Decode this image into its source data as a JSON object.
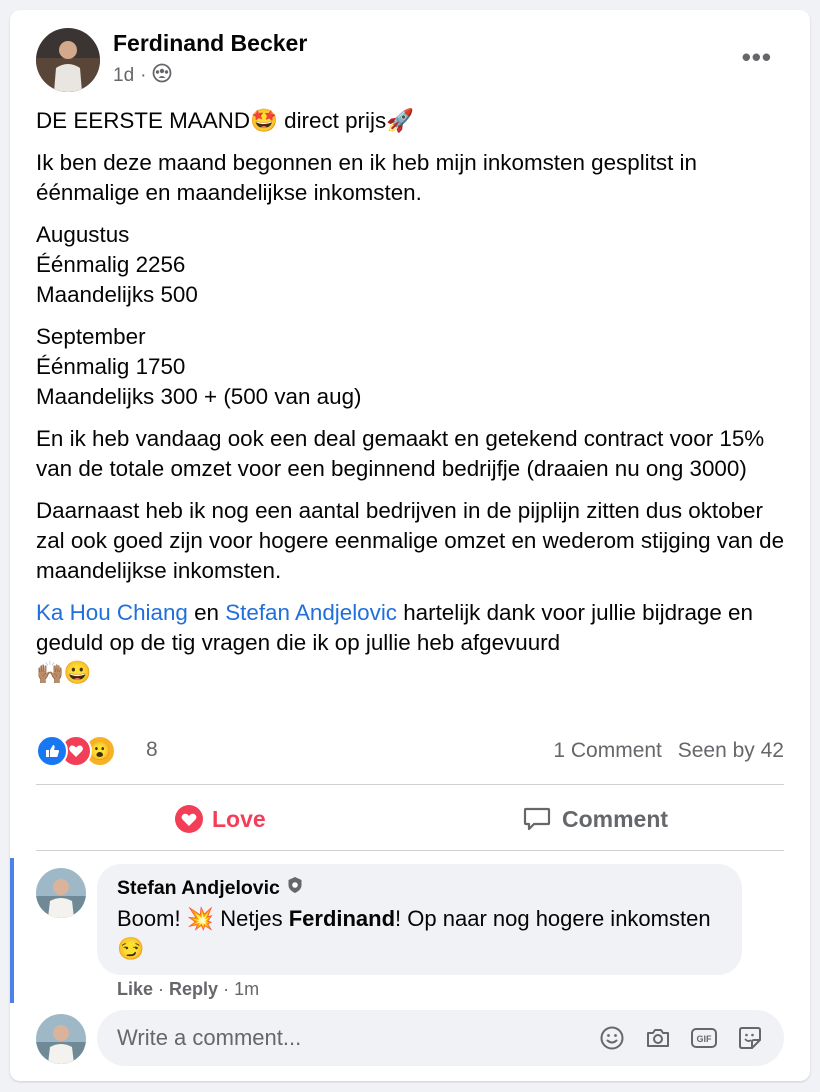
{
  "post": {
    "author": "Ferdinand Becker",
    "time": "1d",
    "separator": "·",
    "more": "•••",
    "title_text": "DE EERSTE MAAND",
    "title_emoji_1": "🤩",
    "title_text_2": " direct prijs",
    "title_emoji_2": "🚀",
    "p2": "Ik ben deze maand begonnen en ik heb mijn inkomsten gesplitst in éénmalige en maandelijkse inkomsten.",
    "aug_1": "Augustus",
    "aug_2": "Éénmalig 2256",
    "aug_3": "Maandelijks 500",
    "sep_1": "September",
    "sep_2": "Éénmalig 1750",
    "sep_3": "Maandelijks 300 + (500 van aug)",
    "p5": "En ik heb vandaag ook een deal gemaakt en getekend contract voor 15% van de totale omzet voor een beginnend bedrijfje (draaien nu ong 3000)",
    "p6": "Daarnaast heb ik nog een aantal bedrijven in de pijplijn zitten dus oktober zal ook goed zijn voor hogere eenmalige omzet en wederom stijging van de maandelijkse inkomsten.",
    "mention_1": "Ka Hou Chiang",
    "and": " en ",
    "mention_2": "Stefan Andjelovic",
    "p7_rest": " hartelijk dank voor jullie bijdrage en geduld op de tig vragen die ik op jullie heb afgevuurd",
    "p7_emoji": "🙌🏽😀"
  },
  "reactions": {
    "count": "8",
    "like_icon": "👍",
    "love_icon": "❤",
    "wow_icon": "😮",
    "comments": "1 Comment",
    "seen": "Seen by 42"
  },
  "actions": {
    "love": "Love",
    "comment": "Comment"
  },
  "comment": {
    "author": "Stefan Andjelovic",
    "text_1": "Boom! ",
    "emoji_1": "💥",
    "text_2": " Netjes ",
    "bold": "Ferdinand",
    "text_3": "! Op naar nog hogere inkomsten ",
    "emoji_2": "😏",
    "like": "Like",
    "reply": "Reply",
    "time": "1m"
  },
  "composer": {
    "placeholder": "Write a comment..."
  },
  "colors": {
    "link": "#216fdb",
    "love": "#f33e58",
    "like": "#1877f2",
    "comment_bar": "#4c82e8"
  }
}
